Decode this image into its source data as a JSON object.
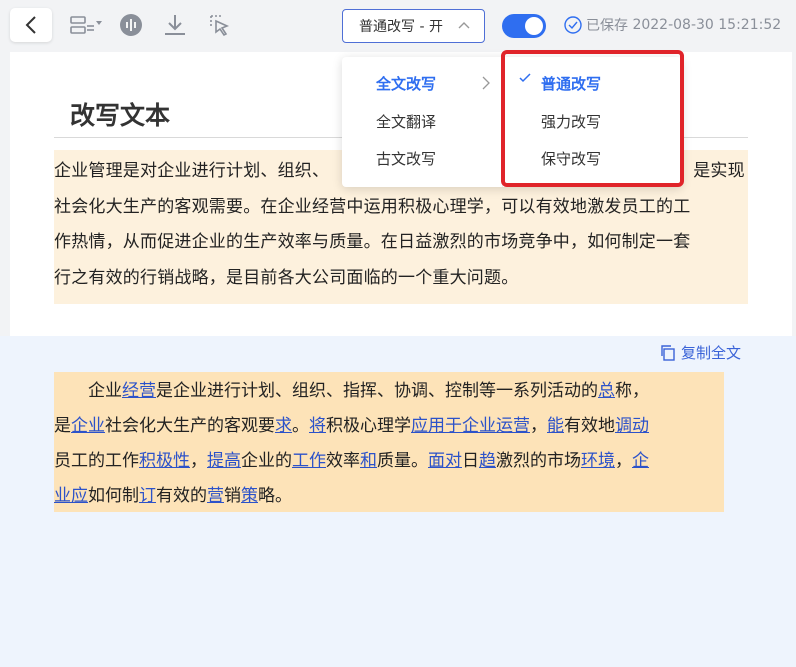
{
  "toolbar": {
    "mode_select": "普通改写 - 开",
    "saved_label": "已保存",
    "saved_time": "2022-08-30 15:21:52"
  },
  "dropdown": {
    "main_items": [
      "全文改写",
      "全文翻译",
      "古文改写"
    ],
    "sub_items": [
      "普通改写",
      "强力改写",
      "保守改写"
    ]
  },
  "original": {
    "title": "改写文本",
    "lines": [
      "企业管理是对企业进行计划、组织、",
      "社会化大生产的客观需要。在企业经营中运用积极心理学，可以有效地激发员工的工",
      "作热情，从而促进企业的生产效率与质量。在日益激烈的市场竞争中，如何制定一套",
      "行之有效的行销战略，是目前各大公司面临的一个重大问题。"
    ],
    "line1_tail": "，是实现"
  },
  "result": {
    "copy_label": "复制全文",
    "lines": [
      [
        [
          "　　企业",
          0
        ],
        [
          "经营",
          1
        ],
        [
          "是企业进行计划、组织、指挥、协调、控制等一系列活动的",
          0
        ],
        [
          "总",
          1
        ],
        [
          "称，",
          0
        ]
      ],
      [
        [
          "是",
          0
        ],
        [
          "企业",
          1
        ],
        [
          "社会化大生产的客观要",
          0
        ],
        [
          "求",
          1
        ],
        [
          "。",
          0
        ],
        [
          "将",
          1
        ],
        [
          "积极心理学",
          0
        ],
        [
          "应用于企业运营",
          1
        ],
        [
          "，",
          0
        ],
        [
          "能",
          1
        ],
        [
          "有效地",
          0
        ],
        [
          "调动",
          1
        ]
      ],
      [
        [
          "员工的工作",
          0
        ],
        [
          "积极性",
          1
        ],
        [
          "，",
          0
        ],
        [
          "提高",
          1
        ],
        [
          "企业的",
          0
        ],
        [
          "工作",
          1
        ],
        [
          "效率",
          0
        ],
        [
          "和",
          1
        ],
        [
          "质量。",
          0
        ],
        [
          "面对",
          1
        ],
        [
          "日",
          0
        ],
        [
          "趋",
          1
        ],
        [
          "激烈的市场",
          0
        ],
        [
          "环境",
          1
        ],
        [
          "，",
          0
        ],
        [
          "企",
          1
        ]
      ],
      [
        [
          "业应",
          1
        ],
        [
          "如何制",
          0
        ],
        [
          "订",
          1
        ],
        [
          "有效的",
          0
        ],
        [
          "营",
          1
        ],
        [
          "销",
          0
        ],
        [
          "策",
          1
        ],
        [
          "略。",
          0
        ]
      ]
    ]
  },
  "colors": {
    "accent": "#2f6ef0",
    "highlight_original": "#fdf1dd",
    "highlight_result": "#fde3b8",
    "result_bg": "#eef4fd",
    "annotation_box": "#e0242a"
  }
}
